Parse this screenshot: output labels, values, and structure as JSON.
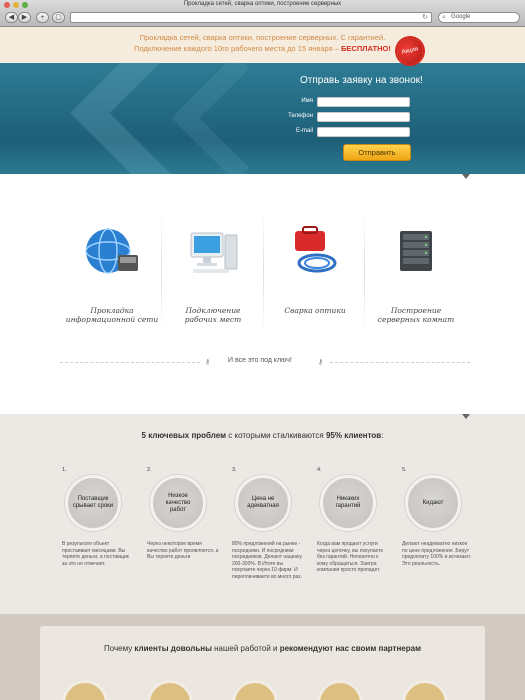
{
  "browser": {
    "title": "Прокладка сетей, сварка оптики, построение серверных",
    "search_placeholder": "Google"
  },
  "promo": {
    "line1": "Прокладка сетей, сварка оптики, построение серверных. С гарантией.",
    "line2": "Подключение каждого 10го рабочего места до 15 января –",
    "free": "БЕСПЛАТНО!",
    "badge": "Акция"
  },
  "form": {
    "title": "Отправь заявку на звонок!",
    "name_label": "Имя",
    "phone_label": "Телефон",
    "email_label": "E-mail",
    "submit": "Отправить"
  },
  "services": {
    "items": [
      {
        "label1": "Прокладка",
        "label2": "информационной сети"
      },
      {
        "label1": "Подключение",
        "label2": "рабочих мест"
      },
      {
        "label1": "Сварка оптики",
        "label2": ""
      },
      {
        "label1": "Построение",
        "label2": "серверных комнат"
      }
    ],
    "turnkey": "И все это под ключ!"
  },
  "problems": {
    "title_pre": "5 ключевых проблем",
    "title_mid": " с которыми сталкиваются ",
    "title_pct": "95% клиентов",
    "title_end": ":",
    "items": [
      {
        "num": "1.",
        "title": "Поставщик срывает сроки",
        "text": "В результате объект простаивает месяцами. Вы теряете деньги, а поставщик за это не отвечает."
      },
      {
        "num": "2.",
        "title": "Низкое качество работ",
        "text": "Через некоторое время качество работ проявляется, а Вы теряете деньги"
      },
      {
        "num": "3.",
        "title": "Цена не адекватная",
        "text": "80% предложений на рынке - посредники. И посредники посредников. Делают наценку 200-300%. В Итоге вы покупаете через 10 фирм. И переплачиваете во много раз."
      },
      {
        "num": "4.",
        "title": "Никаких гарантий",
        "text": "Когда вам продают услуги через цепочку, вы покупаете без гарантий. Непонятно к кому обращаться. Завтра компания просто пропадет."
      },
      {
        "num": "5.",
        "title": "Кидают",
        "text": "Делают неадекватно низкое по цене предложение. Берут предоплату 100% и исчезают. Это реальность."
      }
    ]
  },
  "partners": {
    "pre": "Почему ",
    "b1": "клиенты довольны",
    "mid": " нашей работой и ",
    "b2": "рекомендуют нас своим партнерам"
  },
  "colors": {
    "accent_orange": "#f0a515",
    "promo_text": "#d08a44",
    "free_red": "#d62d20",
    "hero_blue": "#1e5f78"
  }
}
